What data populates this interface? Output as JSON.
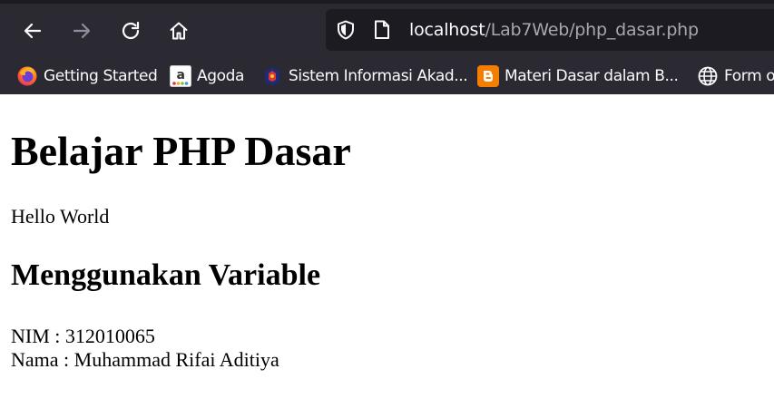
{
  "browser": {
    "url_host": "localhost",
    "url_path": "/Lab7Web/php_dasar.php",
    "chrome_color": "#2b2a33",
    "urlbar_color": "#1c1b22",
    "icons": {
      "back": "arrow-left-icon",
      "forward": "arrow-right-icon",
      "reload": "reload-icon",
      "home": "home-icon",
      "shield": "shield-icon",
      "page": "page-icon"
    },
    "bookmarks": [
      {
        "label": "Getting Started",
        "icon": "firefox-icon"
      },
      {
        "label": "Agoda",
        "icon": "agoda-icon"
      },
      {
        "label": "Sistem Informasi Akad...",
        "icon": "university-logo-icon"
      },
      {
        "label": "Materi Dasar dalam B...",
        "icon": "blogger-icon"
      },
      {
        "label": "Form o",
        "icon": "globe-icon"
      }
    ]
  },
  "page": {
    "heading": "Belajar PHP Dasar",
    "hello": "Hello World",
    "subheading": "Menggunakan Variable",
    "nim_line": "NIM : 312010065",
    "nama_line": "Nama : Muhammad Rifai Aditiya"
  }
}
